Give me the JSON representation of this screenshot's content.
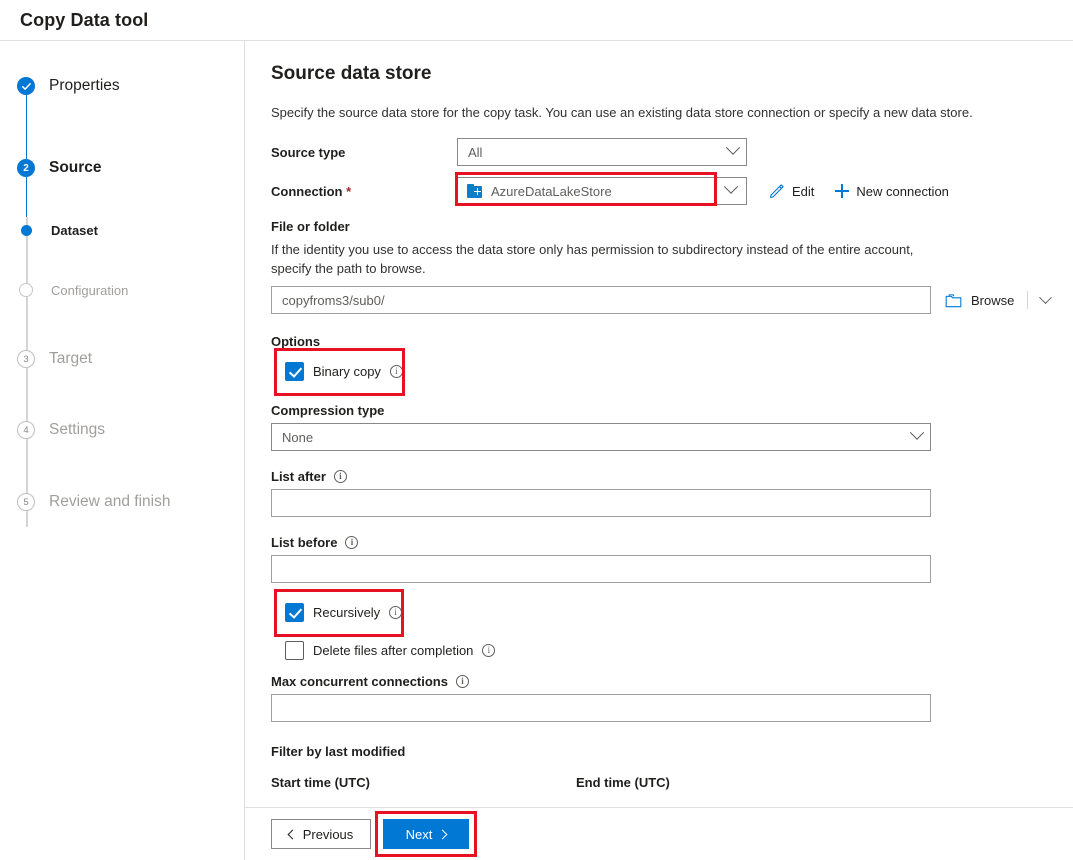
{
  "header": {
    "title": "Copy Data tool"
  },
  "sidebar": {
    "steps": [
      {
        "label": "Properties",
        "marker": "check",
        "state": "done"
      },
      {
        "label": "Source",
        "marker": "2",
        "state": "current"
      },
      {
        "label": "Dataset",
        "marker": "dot",
        "state": "active-sub"
      },
      {
        "label": "Configuration",
        "marker": "circle",
        "state": "inactive-sub"
      },
      {
        "label": "Target",
        "marker": "3",
        "state": "inactive"
      },
      {
        "label": "Settings",
        "marker": "4",
        "state": "inactive"
      },
      {
        "label": "Review and finish",
        "marker": "5",
        "state": "inactive"
      }
    ]
  },
  "main": {
    "title": "Source data store",
    "description": "Specify the source data store for the copy task. You can use an existing data store connection or specify a new data store.",
    "source_type": {
      "label": "Source type",
      "value": "All"
    },
    "connection": {
      "label": "Connection",
      "required_marker": "*",
      "value": "AzureDataLakeStore",
      "icon": "azure-data-lake-store-icon",
      "edit_label": "Edit",
      "new_connection_label": "New connection"
    },
    "file_or_folder": {
      "label": "File or folder",
      "helper": "If the identity you use to access the data store only has permission to subdirectory instead of the entire account, specify the path to browse.",
      "value": "copyfroms3/sub0/",
      "browse_label": "Browse"
    },
    "options": {
      "title": "Options",
      "binary_copy": {
        "label": "Binary copy",
        "checked": true
      },
      "compression_type": {
        "label": "Compression type",
        "value": "None"
      },
      "list_after": {
        "label": "List after",
        "value": ""
      },
      "list_before": {
        "label": "List before",
        "value": ""
      },
      "recursively": {
        "label": "Recursively",
        "checked": true
      },
      "delete_files": {
        "label": "Delete files after completion",
        "checked": false
      },
      "max_concurrent_connections": {
        "label": "Max concurrent connections",
        "value": ""
      }
    },
    "filter": {
      "title": "Filter by last modified",
      "start_time_label": "Start time (UTC)",
      "end_time_label": "End time (UTC)"
    }
  },
  "footer": {
    "previous_label": "Previous",
    "next_label": "Next"
  },
  "colors": {
    "accent": "#0078d4",
    "highlight": "#e81123",
    "required": "#a4262c"
  }
}
